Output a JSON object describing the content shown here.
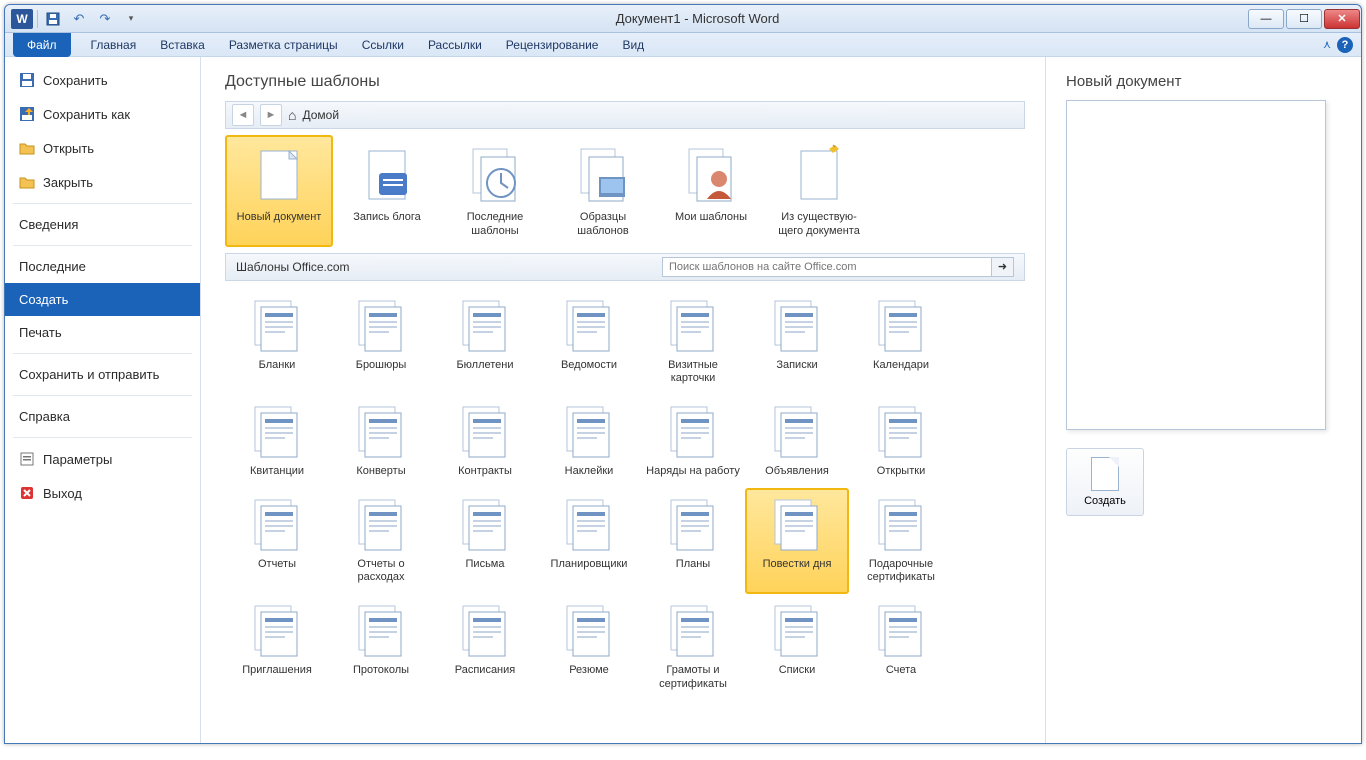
{
  "title": "Документ1  -  Microsoft Word",
  "tabs": {
    "file": "Файл",
    "list": [
      "Главная",
      "Вставка",
      "Разметка страницы",
      "Ссылки",
      "Рассылки",
      "Рецензирование",
      "Вид"
    ]
  },
  "nav": {
    "save": "Сохранить",
    "save_as": "Сохранить как",
    "open": "Открыть",
    "close": "Закрыть",
    "info": "Сведения",
    "recent": "Последние",
    "new": "Создать",
    "print": "Печать",
    "share": "Сохранить и отправить",
    "help": "Справка",
    "options": "Параметры",
    "exit": "Выход"
  },
  "heading": "Доступные шаблоны",
  "crumb_home": "Домой",
  "templates": [
    {
      "label": "Новый документ",
      "key": "new-doc",
      "sel": true
    },
    {
      "label": "Запись блога",
      "key": "blog"
    },
    {
      "label": "Последние шаблоны",
      "key": "recent-tpl"
    },
    {
      "label": "Образцы шаблонов",
      "key": "sample-tpl"
    },
    {
      "label": "Мои шаблоны",
      "key": "my-tpl"
    },
    {
      "label": "Из существую-\nщего документа",
      "key": "from-existing"
    }
  ],
  "office_section": "Шаблоны Office.com",
  "search_placeholder": "Поиск шаблонов на сайте Office.com",
  "categories": [
    {
      "label": "Бланки"
    },
    {
      "label": "Брошюры"
    },
    {
      "label": "Бюллетени"
    },
    {
      "label": "Ведомости"
    },
    {
      "label": "Визитные карточки"
    },
    {
      "label": "Записки"
    },
    {
      "label": "Календари"
    },
    {
      "label": "Квитанции"
    },
    {
      "label": "Конверты"
    },
    {
      "label": "Контракты"
    },
    {
      "label": "Наклейки"
    },
    {
      "label": "Наряды на работу"
    },
    {
      "label": "Объявления"
    },
    {
      "label": "Открытки"
    },
    {
      "label": "Отчеты"
    },
    {
      "label": "Отчеты о расходах"
    },
    {
      "label": "Письма"
    },
    {
      "label": "Планировщики"
    },
    {
      "label": "Планы"
    },
    {
      "label": "Повестки дня",
      "sel": true
    },
    {
      "label": "Подарочные сертификаты"
    },
    {
      "label": "Приглашения"
    },
    {
      "label": "Протоколы"
    },
    {
      "label": "Расписания"
    },
    {
      "label": "Резюме"
    },
    {
      "label": "Грамоты и сертификаты"
    },
    {
      "label": "Списки"
    },
    {
      "label": "Счета"
    }
  ],
  "preview_title": "Новый документ",
  "create_label": "Создать"
}
